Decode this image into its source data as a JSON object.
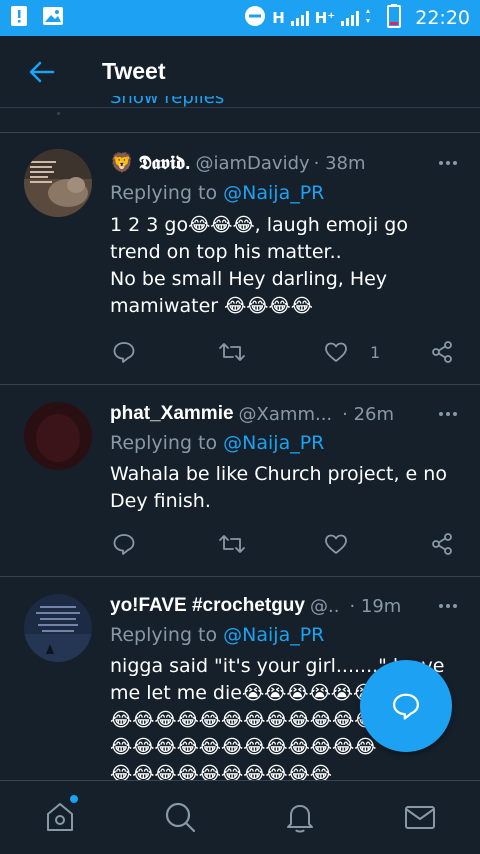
{
  "status_bar": {
    "network_1": "H",
    "network_2": "H⁺",
    "time": "22:20",
    "icons": [
      "alert-icon",
      "image-icon",
      "dnd-icon",
      "signal-icon",
      "battery-icon"
    ]
  },
  "header": {
    "title": "Tweet"
  },
  "show_replies": "Show replies",
  "tweets": [
    {
      "name": "🦁 𝕯𝖆𝖛𝖎𝖉.",
      "handle": "@iamDavidy",
      "time": "· 38m",
      "reply_prefix": "Replying to ",
      "reply_to": "@Naija_PR",
      "body": "1 2 3 go😂😂😂, laugh emoji go trend on top his matter..\nNo be small Hey darling, Hey mamiwater 😂😂😂😂",
      "like_count": "1"
    },
    {
      "name": "phat_Xammie",
      "handle": "@Xamm...",
      "time": "· 26m",
      "reply_prefix": "Replying to ",
      "reply_to": "@Naija_PR",
      "body": "Wahala be like Church project, e no Dey finish.",
      "like_count": ""
    },
    {
      "name": "yo!FAVE #crochetguy",
      "handle": "@..",
      "time": "· 19m",
      "reply_prefix": "Replying to ",
      "reply_to": "@Naija_PR",
      "body": "nigga said \"it's your girl.......\" leave me let me die😭😭😭😭😭😭\n😂😂😂😂😂😂😂😂😂😂😂😂\n😂😂😂😂😂😂😂😂😂😂😂😂\n😂😂😂😂😂😂😂😂😂😂",
      "like_count": ""
    }
  ],
  "colors": {
    "background": "#15202b",
    "accent": "#1da1f2",
    "muted": "#8899a6",
    "divider": "#38444d"
  }
}
